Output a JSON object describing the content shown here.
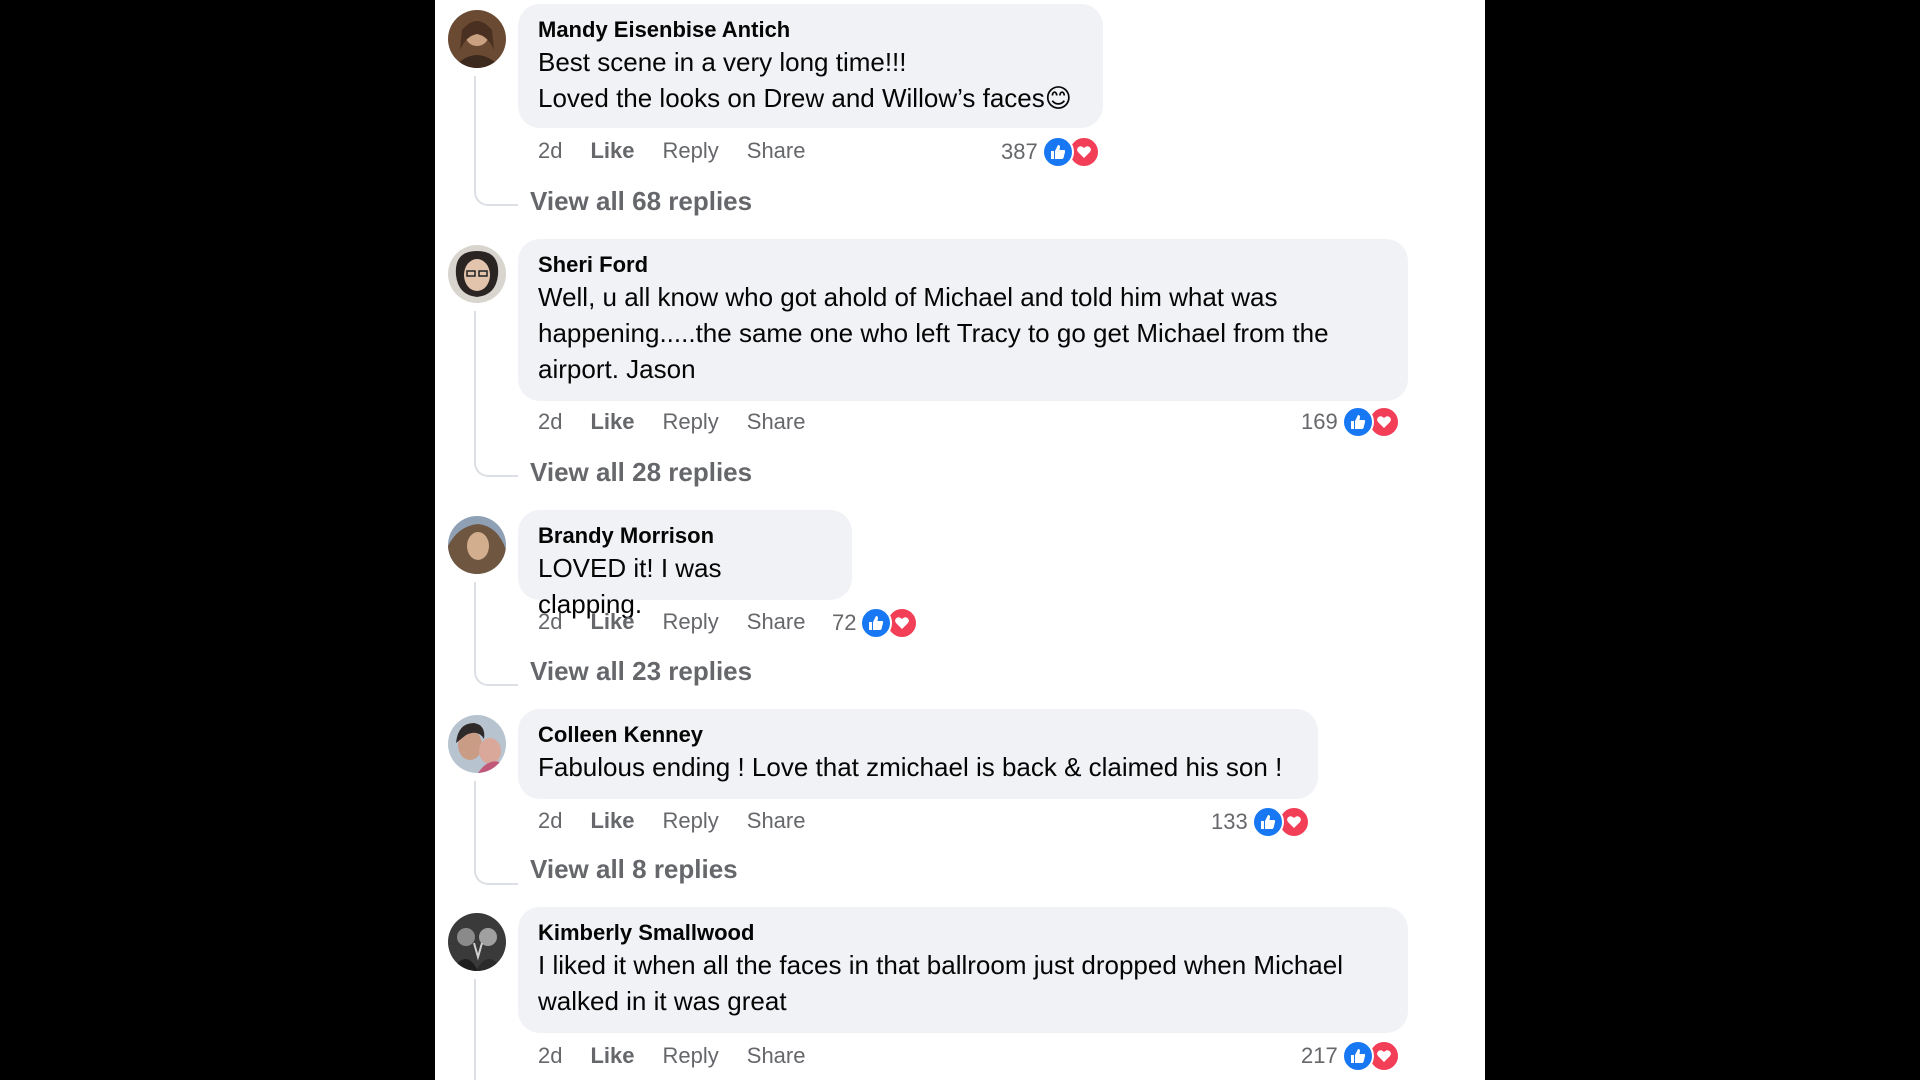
{
  "comments": [
    {
      "author": "Mandy Eisenbise Antich",
      "lines": [
        "Best scene in a very long time!!!",
        "Loved the looks on Drew and Willow’s faces😊"
      ],
      "time": "2d",
      "like": "Like",
      "reply": "Reply",
      "share": "Share",
      "count": "387",
      "view_replies": "View all 68 replies"
    },
    {
      "author": "Sheri Ford",
      "lines": [
        "Well, u all know who got ahold of Michael and told him what was",
        "happening.....the same one who left Tracy to go get Michael from the",
        "airport. Jason"
      ],
      "time": "2d",
      "like": "Like",
      "reply": "Reply",
      "share": "Share",
      "count": "169",
      "view_replies": "View all 28 replies"
    },
    {
      "author": "Brandy Morrison",
      "lines": [
        "LOVED it! I was clapping."
      ],
      "time": "2d",
      "like": "Like",
      "reply": "Reply",
      "share": "Share",
      "count": "72",
      "view_replies": "View all 23 replies"
    },
    {
      "author": "Colleen Kenney",
      "lines": [
        "Fabulous ending ! Love that zmichael is back & claimed his son !"
      ],
      "time": "2d",
      "like": "Like",
      "reply": "Reply",
      "share": "Share",
      "count": "133",
      "view_replies": "View all 8 replies"
    },
    {
      "author": "Kimberly Smallwood",
      "lines": [
        "I liked it when all the faces in that ballroom just dropped when Michael",
        "walked in it was great"
      ],
      "time": "2d",
      "like": "Like",
      "reply": "Reply",
      "share": "Share",
      "count": "217",
      "view_replies": ""
    }
  ],
  "colors": {
    "like": "#1877f2",
    "love": "#f33e58",
    "bubble": "#f0f2f5",
    "muted_text": "#65676b"
  },
  "icons": {
    "like": "thumbs-up-icon",
    "love": "heart-icon"
  }
}
